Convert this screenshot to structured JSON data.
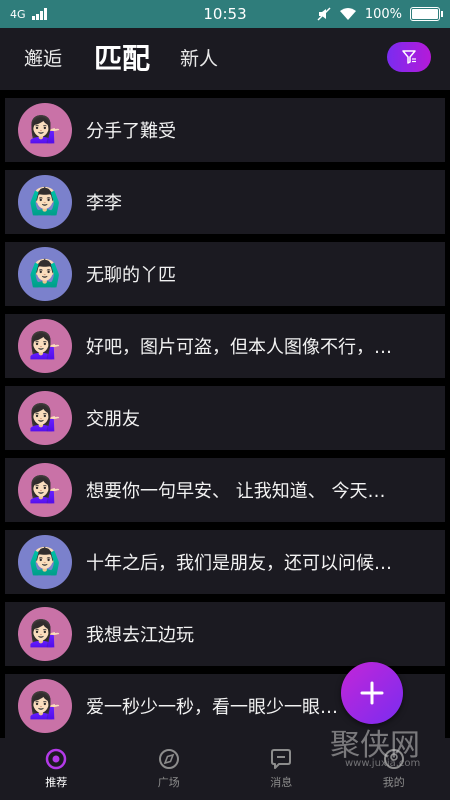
{
  "status_bar": {
    "network": "4G",
    "time": "10:53",
    "battery": "100%",
    "battery_level": 1.0
  },
  "top_nav": {
    "tabs": [
      {
        "label": "邂逅"
      },
      {
        "label": "匹配"
      },
      {
        "label": "新人"
      }
    ],
    "active_tab": "匹配"
  },
  "list": {
    "items": [
      {
        "text": "分手了難受",
        "avatar_color": "#c972a7",
        "avatar_emoji": "💁🏻‍♀️"
      },
      {
        "text": "李李",
        "avatar_color": "#7b81cc",
        "avatar_emoji": "🙆🏻‍♂️"
      },
      {
        "text": "无聊的丫匹",
        "avatar_color": "#7b81cc",
        "avatar_emoji": "🙆🏻‍♂️"
      },
      {
        "text": "好吧，图片可盗，但本人图像不行，…",
        "avatar_color": "#c972a7",
        "avatar_emoji": "💁🏻‍♀️"
      },
      {
        "text": "交朋友",
        "avatar_color": "#c972a7",
        "avatar_emoji": "💁🏻‍♀️"
      },
      {
        "text": "想要你一句早安、 让我知道、 今天…",
        "avatar_color": "#c972a7",
        "avatar_emoji": "💁🏻‍♀️"
      },
      {
        "text": "十年之后，我们是朋友，还可以问候…",
        "avatar_color": "#7b81cc",
        "avatar_emoji": "🙆🏻‍♂️"
      },
      {
        "text": "我想去江边玩",
        "avatar_color": "#c972a7",
        "avatar_emoji": "💁🏻‍♀️"
      },
      {
        "text": "爱一秒少一秒，看一眼少一眼…",
        "avatar_color": "#c972a7",
        "avatar_emoji": "💁🏻‍♀️"
      }
    ]
  },
  "fab": {
    "icon": "plus-icon"
  },
  "bottom_nav": {
    "items": [
      {
        "label": "推荐",
        "icon": "eye-icon",
        "active": true
      },
      {
        "label": "广场",
        "icon": "compass-icon",
        "active": false
      },
      {
        "label": "消息",
        "icon": "chat-icon",
        "active": false
      },
      {
        "label": "我的",
        "icon": "user-icon",
        "active": false
      }
    ]
  },
  "watermark": {
    "text": "聚侠网",
    "url": "www.juxia.com"
  },
  "colors": {
    "status_bar": "#2f7d7b",
    "panel": "#1b1a21",
    "accent_start": "#7a2cf0",
    "accent_end": "#c326d8",
    "avatar_pink": "#c972a7",
    "avatar_blue": "#7b81cc"
  }
}
